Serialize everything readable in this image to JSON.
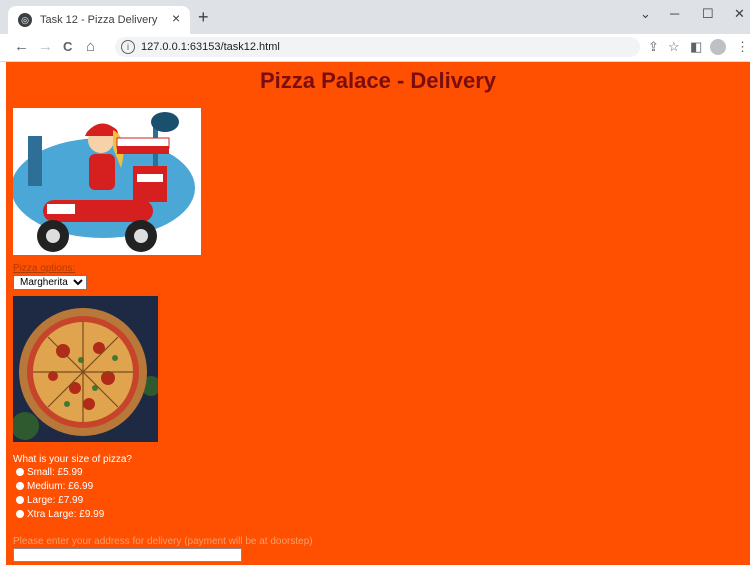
{
  "browser": {
    "tab_title": "Task 12 - Pizza Delivery",
    "tab_close": "×",
    "new_tab": "+",
    "minimize": "─",
    "maximize": "☐",
    "close": "✕",
    "back": "←",
    "forward": "→",
    "reload": "C",
    "home": "⌂",
    "url": "127.0.0.1:63153/task12.html",
    "share": "⇪",
    "star": "☆",
    "sidepanel": "◧",
    "menu": "⋮"
  },
  "page": {
    "heading": "Pizza Palace - Delivery",
    "pizza_label": "Pizza options:",
    "pizza_selected": "Margherita",
    "size_question": "What is your size of pizza?",
    "sizes": [
      "Small: £5.99",
      "Medium: £6.99",
      "Large: £7.99",
      "Xtra Large: £9.99"
    ],
    "address_label": "Please enter your address for delivery (payment will be at doorstep)",
    "address_value": ""
  },
  "colors": {
    "page_background": "#ff4f00",
    "heading": "#7a0e0e"
  }
}
